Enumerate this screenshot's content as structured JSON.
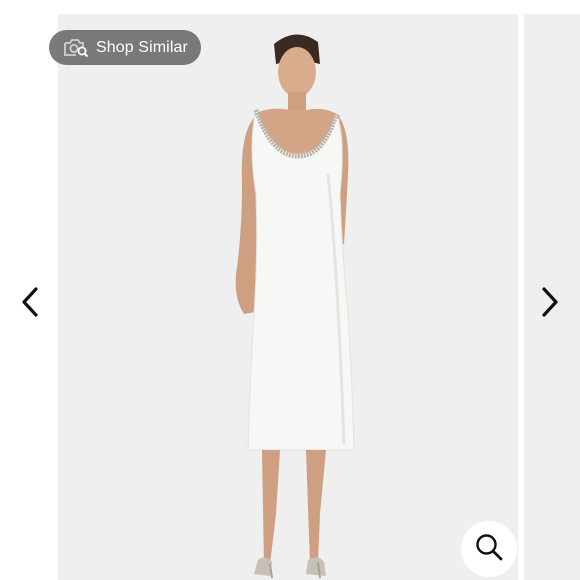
{
  "shop_similar": {
    "label": "Shop Similar",
    "icon": "camera-search-icon"
  },
  "navigation": {
    "prev_icon": "chevron-left-icon",
    "next_icon": "chevron-right-icon"
  },
  "zoom": {
    "icon": "magnifier-icon"
  },
  "colors": {
    "slide_background": "#efefef",
    "pill_background": "#696969",
    "dress": "#f7f7f5"
  }
}
